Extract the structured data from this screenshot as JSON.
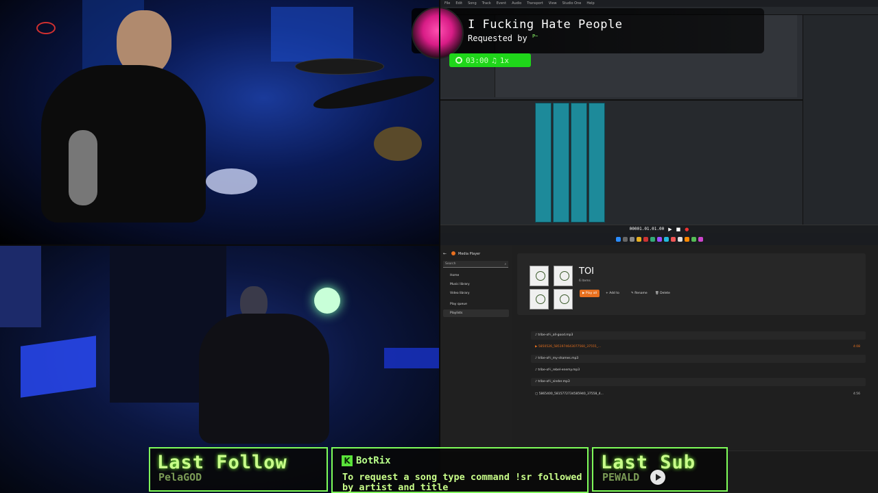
{
  "song_request": {
    "title": "I Fucking Hate People",
    "requested_by_label": "Requested by",
    "requester": "P~",
    "timer": "03:00",
    "speed": "1x"
  },
  "daw": {
    "menu": [
      "File",
      "Edit",
      "Song",
      "Track",
      "Event",
      "Audio",
      "Transport",
      "View",
      "Studio One",
      "Help"
    ],
    "transport_time": "00001.01.01.00"
  },
  "media_player": {
    "app_name": "Media Player",
    "search_placeholder": "Search",
    "nav": [
      "Home",
      "Music library",
      "Video library",
      "Play queue",
      "Playlists"
    ],
    "playlist_title": "TOI",
    "item_count": "6 items",
    "buttons": [
      "Play all",
      "Add to",
      "Rename",
      "Delete"
    ],
    "rows": [
      {
        "name": "tribe-of-i_all-good.mp3",
        "duration": ""
      },
      {
        "name": "5850526_5851974643077560_37555_...",
        "duration": "4:08"
      },
      {
        "name": "tribe-of-i_my-shames.mp3",
        "duration": ""
      },
      {
        "name": "tribe-of-i_rebel-enemy.mp3",
        "duration": ""
      },
      {
        "name": "tribe-of-i_sinder.mp3",
        "duration": ""
      },
      {
        "name": "5865400_5815772734585940_37558_4...",
        "duration": "4:56"
      }
    ],
    "settings_label": "Settings"
  },
  "overlays": {
    "last_follow_label": "Last Follow",
    "last_follow_name": "PelaGOD",
    "bot_name": "BotRix",
    "bot_message": "To request a song type command !sr followed by artist and title",
    "last_sub_label": "Last Sub",
    "last_sub_name": "PEWALD"
  },
  "colors": {
    "accent_green": "#7fff5a",
    "media_orange": "#e8701f",
    "mixer_teal": "#1d8a9a"
  }
}
